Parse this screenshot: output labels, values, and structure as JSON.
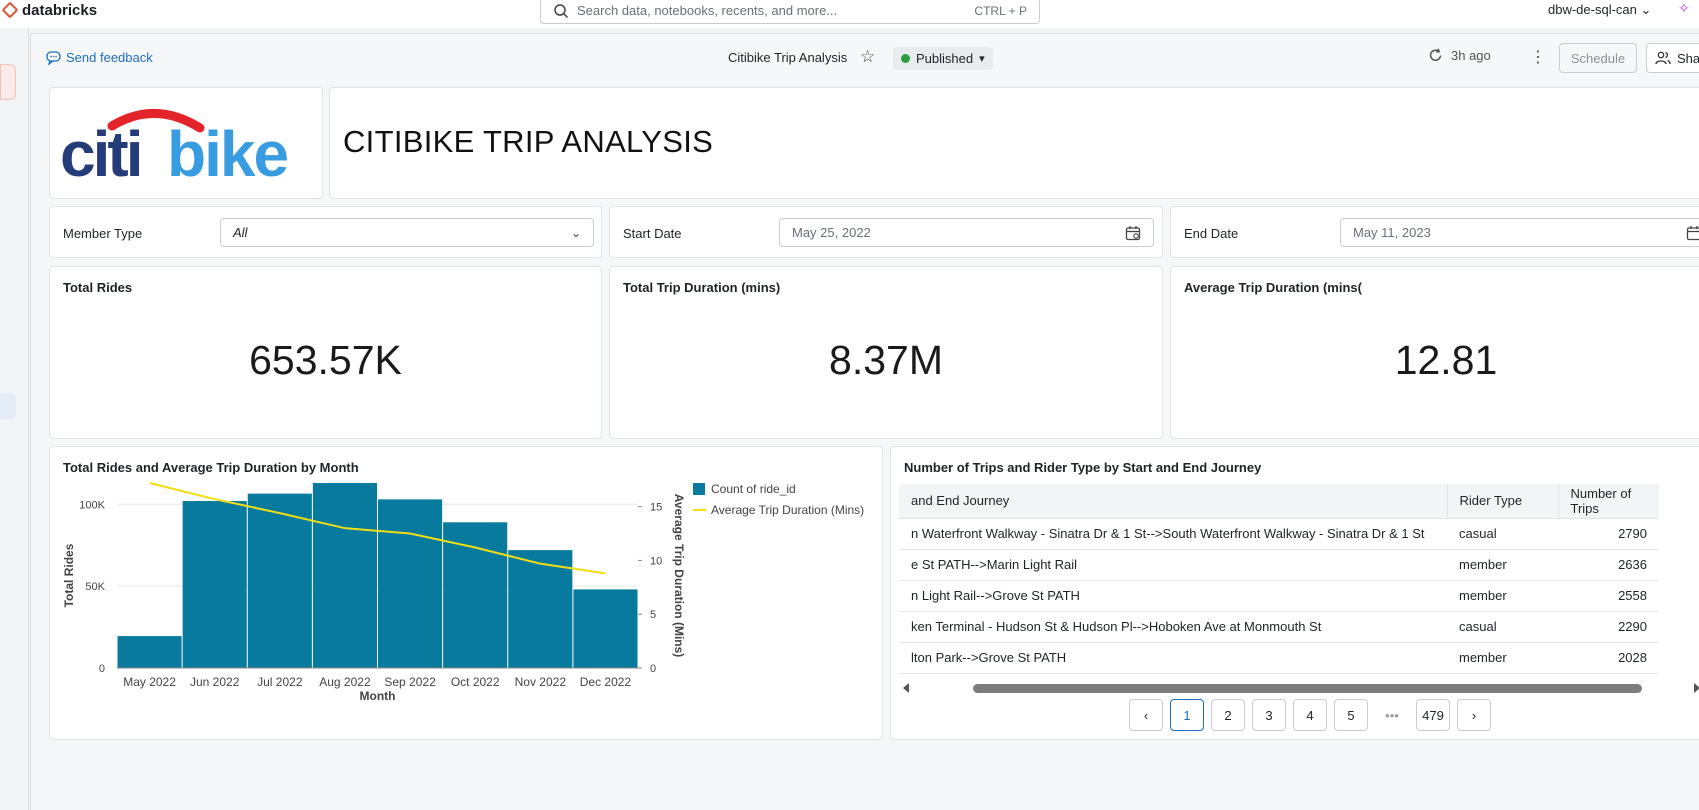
{
  "topbar": {
    "brand": "databricks",
    "search_placeholder": "Search data, notebooks, recents, and more...",
    "search_shortcut": "CTRL + P",
    "workspace": "dbw-de-sql-can",
    "workspace_chevron": "⌄",
    "assistant_icon": "sparkle-icon"
  },
  "toolbar": {
    "feedback_label": "Send feedback",
    "dashboard_title": "Citibike Trip Analysis",
    "status_label": "Published",
    "status_color": "#2a9d3a",
    "refresh_label": "3h ago",
    "schedule_label": "Schedule",
    "share_label": "Sha"
  },
  "header": {
    "logo_text": "citibike",
    "logo_colors": {
      "citi": "#243c78",
      "bike": "#3a9ce0",
      "arc": "#e3242b"
    },
    "title": "CITIBIKE TRIP ANALYSIS"
  },
  "filters": {
    "member_type_label": "Member Type",
    "member_type_value": "All",
    "start_date_label": "Start Date",
    "start_date_value": "May 25, 2022",
    "end_date_label": "End Date",
    "end_date_value": "May 11, 2023"
  },
  "kpis": [
    {
      "label": "Total Rides",
      "value": "653.57K"
    },
    {
      "label": "Total Trip Duration (mins)",
      "value": "8.37M"
    },
    {
      "label": "Average Trip Duration (mins(",
      "value": "12.81"
    }
  ],
  "chart_data": {
    "type": "bar",
    "title": "Total Rides and Average Trip Duration by Month",
    "categories": [
      "May 2022",
      "Jun 2022",
      "Jul 2022",
      "Aug 2022",
      "Sep 2022",
      "Oct 2022",
      "Nov 2022",
      "Dec 2022"
    ],
    "series": [
      {
        "name": "Count of ride_id",
        "type": "bar",
        "color": "#077a9d",
        "axis": "left",
        "values": [
          19500,
          102000,
          106500,
          113000,
          103000,
          89000,
          72000,
          48000
        ]
      },
      {
        "name": "Average Trip Duration (Mins)",
        "type": "line",
        "color": "#f2de16",
        "axis": "right",
        "values": [
          17.2,
          15.7,
          14.4,
          13.0,
          12.5,
          11.2,
          9.7,
          8.8
        ]
      }
    ],
    "xlabel": "Month",
    "ylabel": "Total Rides",
    "y2label": "Average Trip Duration (Mins)",
    "ylim": [
      0,
      113000
    ],
    "y2lim": [
      0,
      17.2
    ],
    "yticks": [
      "0",
      "50K",
      "100K"
    ],
    "y2ticks": [
      "0",
      "5",
      "10",
      "15"
    ],
    "legend": "top-right",
    "grid": true
  },
  "trips_table": {
    "title": "Number of Trips and Rider Type by Start and End Journey",
    "columns": [
      "and End Journey",
      "Rider Type",
      "Number of Trips"
    ],
    "rows": [
      [
        "n Waterfront Walkway - Sinatra Dr & 1 St-->South Waterfront Walkway - Sinatra Dr & 1 St",
        "casual",
        "2790"
      ],
      [
        "e St PATH-->Marin Light Rail",
        "member",
        "2636"
      ],
      [
        "n Light Rail-->Grove St PATH",
        "member",
        "2558"
      ],
      [
        "ken Terminal - Hudson St & Hudson Pl-->Hoboken Ave at Monmouth St",
        "casual",
        "2290"
      ],
      [
        "lton Park-->Grove St PATH",
        "member",
        "2028"
      ]
    ],
    "pages": [
      "1",
      "2",
      "3",
      "4",
      "5"
    ],
    "last_page": "479",
    "current_page": "1"
  }
}
